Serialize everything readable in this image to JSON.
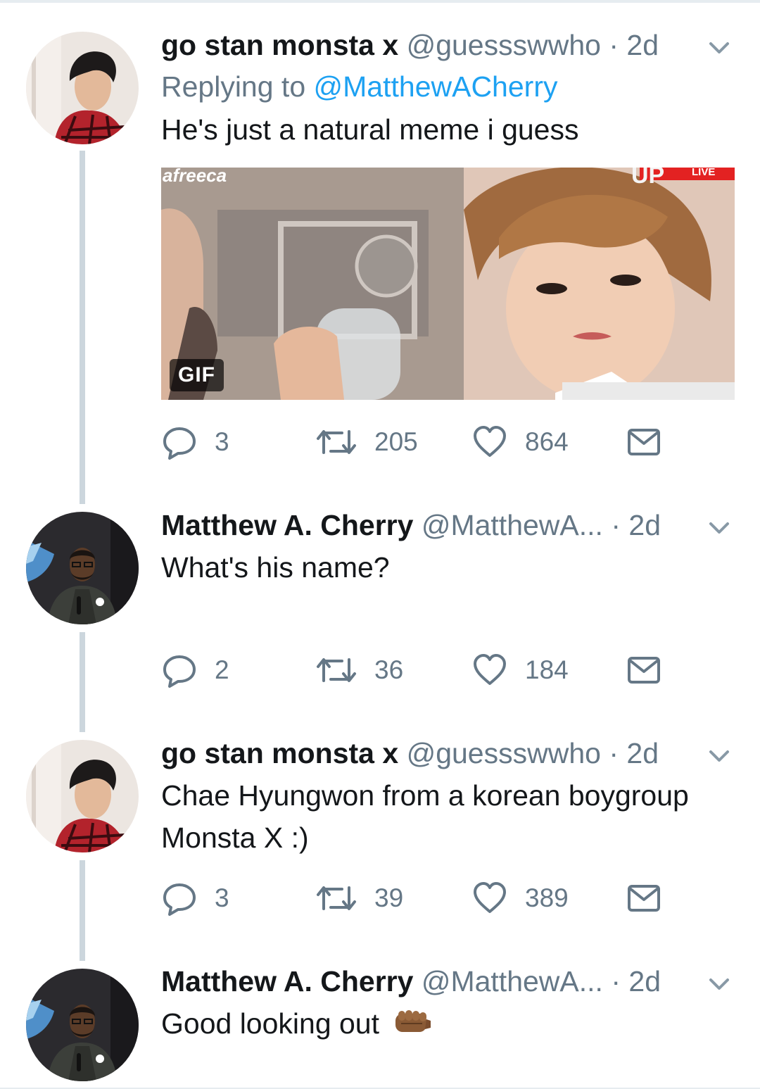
{
  "colors": {
    "link": "#1da1f2",
    "secondary_text": "#657786",
    "primary_text": "#14171a",
    "thread_line": "#ccd6dd"
  },
  "tweets": [
    {
      "display_name": "go stan monsta x",
      "handle": "@guessswwho",
      "separator": "·",
      "time": "2d",
      "reply_prefix": "Replying to",
      "reply_mention": "@MatthewACherry",
      "text": "He's just a natural meme i guess",
      "media": {
        "badge": "GIF",
        "watermark_left": "afreeca",
        "watermark_right": "UP",
        "live_label": "LIVE"
      },
      "replies": "3",
      "retweets": "205",
      "likes": "864"
    },
    {
      "display_name": "Matthew A. Cherry",
      "handle": "@MatthewA...",
      "separator": "·",
      "time": "2d",
      "text": "What's his name?",
      "replies": "2",
      "retweets": "36",
      "likes": "184"
    },
    {
      "display_name": "go stan monsta x",
      "handle": "@guessswwho",
      "separator": "·",
      "time": "2d",
      "text_line1": "Chae Hyungwon from a korean boygroup",
      "text_line2": "Monsta X :)",
      "replies": "3",
      "retweets": "39",
      "likes": "389"
    },
    {
      "display_name": "Matthew A. Cherry",
      "handle": "@MatthewA...",
      "separator": "·",
      "time": "2d",
      "text": "Good looking out",
      "emoji": "fist-bump-emoji"
    }
  ],
  "icons": {
    "reply": "reply-icon",
    "retweet": "retweet-icon",
    "like": "heart-icon",
    "dm": "envelope-icon",
    "menu": "chevron-down-icon"
  }
}
